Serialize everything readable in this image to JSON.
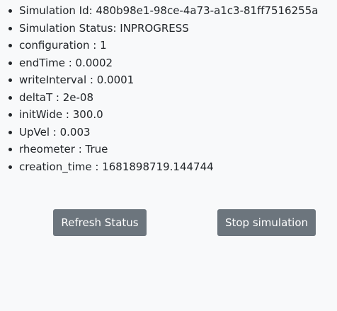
{
  "details": [
    {
      "label": "Simulation Id: 480b98e1-98ce-4a73-a1c3-81ff7516255a"
    },
    {
      "label": "Simulation Status: INPROGRESS"
    },
    {
      "label": "configuration : 1"
    },
    {
      "label": "endTime : 0.0002"
    },
    {
      "label": "writeInterval : 0.0001"
    },
    {
      "label": "deltaT : 2e-08"
    },
    {
      "label": "initWide : 300.0"
    },
    {
      "label": "UpVel : 0.003"
    },
    {
      "label": "rheometer : True"
    },
    {
      "label": "creation_time : 1681898719.144744"
    }
  ],
  "actions": {
    "refresh_label": "Refresh Status",
    "stop_label": "Stop simulation"
  },
  "colors": {
    "background": "#f8f9fa",
    "button": "#6c757d",
    "button_text": "#ffffff",
    "text": "#212529"
  }
}
